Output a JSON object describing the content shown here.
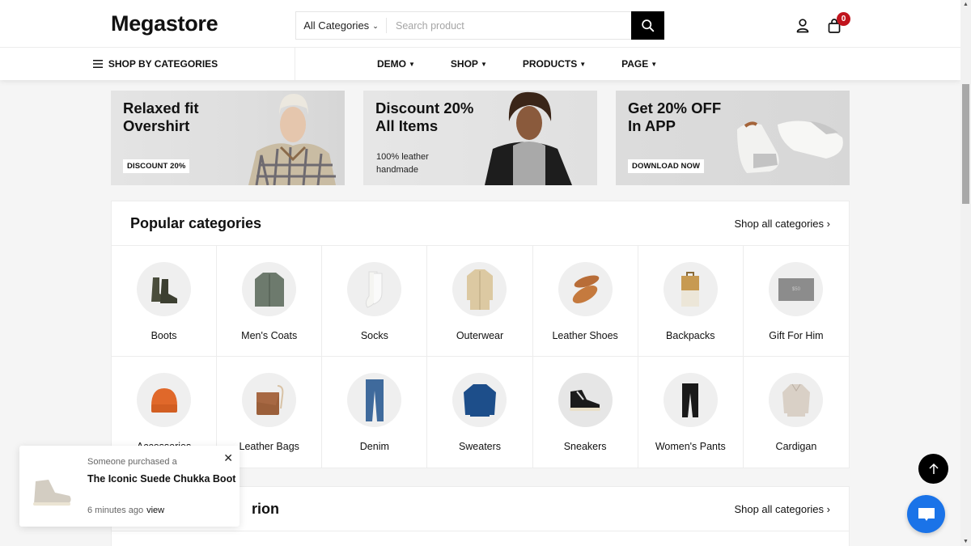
{
  "header": {
    "logo": "Megastore",
    "search": {
      "category": "All Categories",
      "placeholder": "Search product",
      "value": ""
    },
    "cart_count": "0"
  },
  "nav": {
    "shop_by_categories": "SHOP BY CATEGORIES",
    "items": [
      {
        "label": "DEMO"
      },
      {
        "label": "SHOP"
      },
      {
        "label": "PRODUCTS"
      },
      {
        "label": "PAGE"
      }
    ]
  },
  "banners": [
    {
      "title": "Relaxed fit\nOvershirt",
      "tag": "DISCOUNT 20%"
    },
    {
      "title": "Discount 20%\nAll Items",
      "subtitle": "100% leather\n handmade"
    },
    {
      "title": "Get 20% OFF\nIn APP",
      "tag": "DOWNLOAD NOW"
    }
  ],
  "popular_categories": {
    "title": "Popular categories",
    "shop_all": "Shop all categories",
    "items": [
      {
        "label": "Boots",
        "icon": "boots"
      },
      {
        "label": "Men's Coats",
        "icon": "coat"
      },
      {
        "label": "Socks",
        "icon": "socks"
      },
      {
        "label": "Outerwear",
        "icon": "outerwear"
      },
      {
        "label": "Leather Shoes",
        "icon": "loafers"
      },
      {
        "label": "Backpacks",
        "icon": "backpack"
      },
      {
        "label": "Gift For Him",
        "icon": "gift-card"
      },
      {
        "label": "Accessories",
        "icon": "beanie"
      },
      {
        "label": "Leather Bags",
        "icon": "bag"
      },
      {
        "label": "Denim",
        "icon": "jeans"
      },
      {
        "label": "Sweaters",
        "icon": "sweater"
      },
      {
        "label": "Sneakers",
        "icon": "sneakers"
      },
      {
        "label": "Women's Pants",
        "icon": "pants"
      },
      {
        "label": "Cardigan",
        "icon": "cardigan"
      }
    ]
  },
  "second_section": {
    "title_visible": "rion",
    "shop_all": "Shop all categories"
  },
  "toast": {
    "line1": "Someone purchased a",
    "product": "The Iconic Suede Chukka Boot",
    "time": "6 minutes ago",
    "view": "view"
  },
  "gift_card_text": "$50",
  "colors": {
    "badge": "#c1141d",
    "chat": "#1a73e8",
    "accent": "#000000"
  }
}
